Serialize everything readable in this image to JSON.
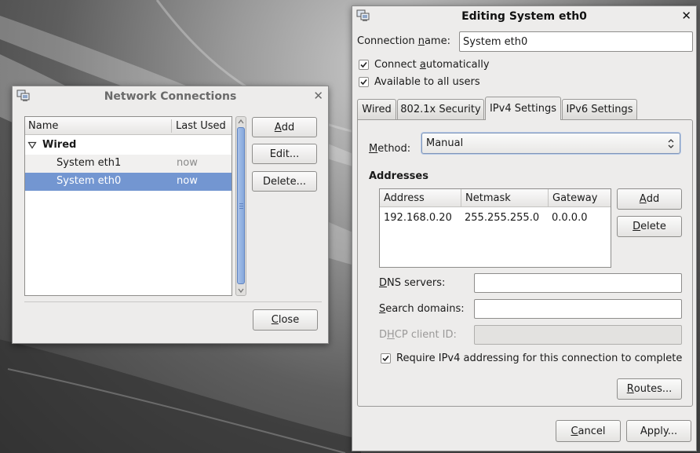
{
  "network_connections": {
    "title": "Network Connections",
    "close_symbol": "✕",
    "list": {
      "columns": [
        "Name",
        "Last Used"
      ],
      "group": {
        "label": "Wired",
        "expanded": true
      },
      "rows": [
        {
          "name": "System eth1",
          "last_used": "now",
          "selected": false
        },
        {
          "name": "System eth0",
          "last_used": "now",
          "selected": true
        }
      ]
    },
    "buttons": {
      "add_mnemonic": "A",
      "add_rest": "dd",
      "edit": "Edit...",
      "delete": "Delete...",
      "close_mnemonic": "C",
      "close_rest": "lose"
    },
    "icons": {
      "window": "network-computers-icon",
      "expander": "triangle-down-icon"
    }
  },
  "editing": {
    "title": "Editing System eth0",
    "close_symbol": "✕",
    "connection_name_label_pre": "Connection ",
    "connection_name_label_mnemonic": "n",
    "connection_name_label_post": "ame:",
    "connection_name_value": "System eth0",
    "connect_auto_pre": "Connect ",
    "connect_auto_mnemonic": "a",
    "connect_auto_post": "utomatically",
    "connect_auto_checked": true,
    "all_users_label": "Available to all users",
    "all_users_checked": true,
    "tabs": [
      {
        "label": "Wired",
        "active": false
      },
      {
        "label": "802.1x Security",
        "active": false
      },
      {
        "label": "IPv4 Settings",
        "active": true
      },
      {
        "label": "IPv6 Settings",
        "active": false
      }
    ],
    "ipv4": {
      "method_label_mnemonic": "M",
      "method_label_rest": "ethod:",
      "method_value": "Manual",
      "addresses_heading": "Addresses",
      "columns": [
        "Address",
        "Netmask",
        "Gateway"
      ],
      "rows": [
        {
          "address": "192.168.0.20",
          "netmask": "255.255.255.0",
          "gateway": "0.0.0.0"
        }
      ],
      "add_mnemonic": "A",
      "add_rest": "dd",
      "delete_mnemonic": "D",
      "delete_rest": "elete",
      "dns_mnemonic": "D",
      "dns_rest": "NS servers:",
      "dns_value": "",
      "search_mnemonic": "S",
      "search_rest": "earch domains:",
      "search_value": "",
      "dhcp_pre": "D",
      "dhcp_mnemonic": "H",
      "dhcp_rest": "CP client ID:",
      "dhcp_value": "",
      "require_label": "Require IPv4 addressing for this connection to complete",
      "require_checked": true,
      "routes_mnemonic": "R",
      "routes_rest": "outes..."
    },
    "cancel_mnemonic": "C",
    "cancel_rest": "ancel",
    "apply": "Apply..."
  },
  "colors": {
    "selection": "#7396d1",
    "window_bg": "#edeceb"
  }
}
